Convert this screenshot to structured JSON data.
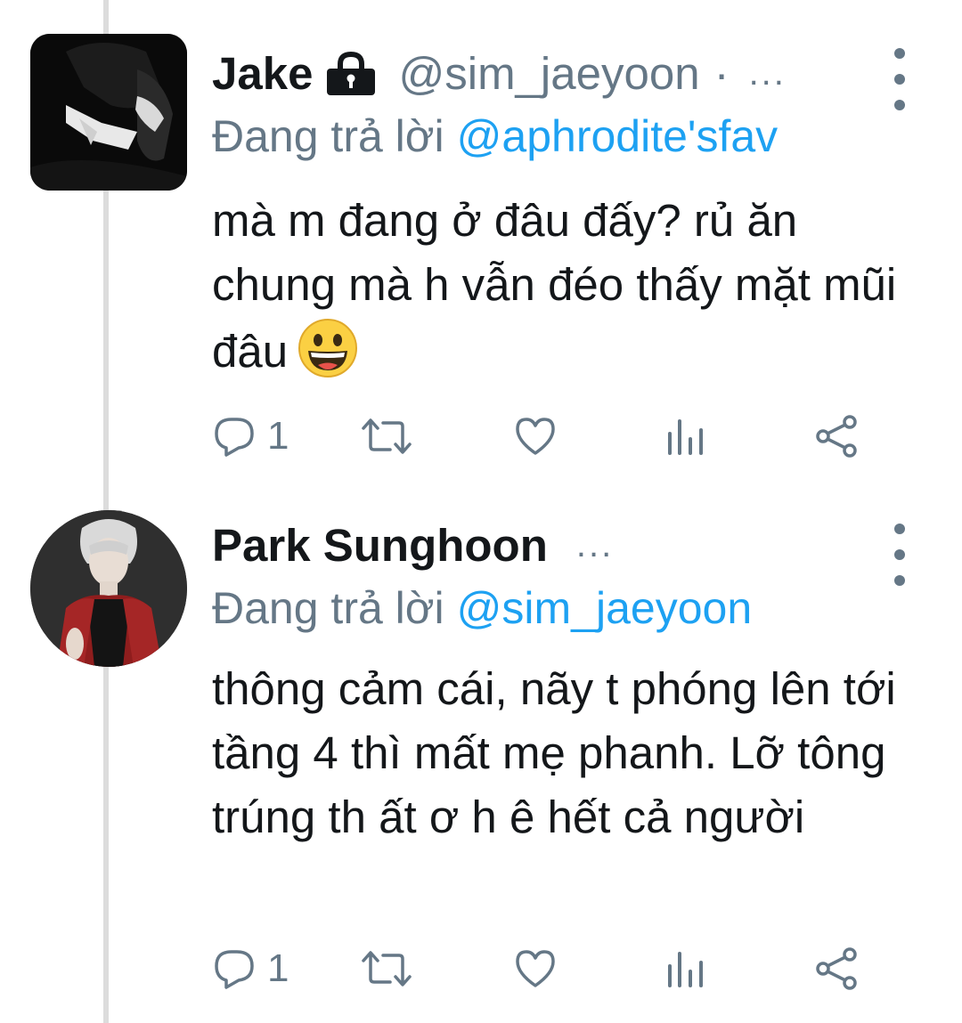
{
  "tweets": [
    {
      "name": "Jake",
      "handle": "@sim_jaeyoon",
      "separator": "·",
      "ellipsis": "...",
      "protected": true,
      "reply_prefix": "Đang trả lời",
      "reply_to": "@aphrodite'sfav",
      "text": "mà m đang ở đâu đấy? rủ ăn chung mà h vẫn đéo thấy mặt mũi đâu",
      "emoji": "grinning-face",
      "reply_count": "1"
    },
    {
      "name": "Park Sunghoon",
      "ellipsis": "...",
      "protected": false,
      "reply_prefix": "Đang trả lời",
      "reply_to": "@sim_jaeyoon",
      "text": "thông cảm cái, nãy t phóng lên tới tầng 4 thì mất mẹ phanh. Lỡ tông trúng th ất ơ h ê hết cả người",
      "reply_count": "1"
    }
  ],
  "icons": {
    "reply": "reply-icon",
    "retweet": "retweet-icon",
    "like": "heart-icon",
    "analytics": "analytics-icon",
    "share": "share-icon",
    "more": "more-vertical-icon",
    "lock": "lock-icon"
  },
  "colors": {
    "text": "#14171a",
    "secondary": "#657786",
    "mention": "#1da1f2",
    "thread_line": "#dcdcdc"
  }
}
